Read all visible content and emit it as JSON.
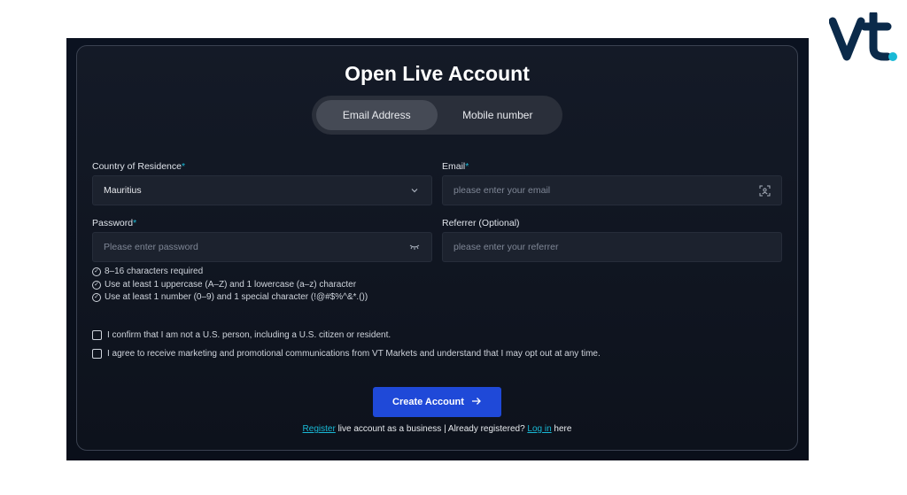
{
  "brand": {
    "logo_text": "vt",
    "accent": "#19b9d6"
  },
  "form": {
    "title": "Open Live Account",
    "tabs": [
      {
        "label": "Email Address",
        "active": true
      },
      {
        "label": "Mobile number",
        "active": false
      }
    ],
    "country": {
      "label": "Country of Residence",
      "required_mark": "*",
      "value": "Mauritius"
    },
    "email": {
      "label": "Email",
      "required_mark": "*",
      "placeholder": "please enter your email"
    },
    "password": {
      "label": "Password",
      "required_mark": "*",
      "placeholder": "Please enter password"
    },
    "referrer": {
      "label": "Referrer (Optional)",
      "placeholder": "please enter your referrer"
    },
    "password_rules": [
      "8–16 characters required",
      "Use at least 1 uppercase (A–Z) and 1 lowercase (a–z) character",
      "Use at least 1 number (0–9) and 1 special character (!@#$%^&*.())"
    ],
    "consents": [
      "I confirm that I am not a U.S. person, including a U.S. citizen or resident.",
      "I agree to receive marketing and promotional communications from VT Markets and understand that I may opt out at any time."
    ],
    "submit_label": "Create Account",
    "footer": {
      "register_link": "Register",
      "middle_text": " live account as a business | Already registered? ",
      "login_link": "Log in",
      "end_text": " here"
    }
  },
  "colors": {
    "button": "#1f49d8",
    "card_bg": "#141a27"
  }
}
